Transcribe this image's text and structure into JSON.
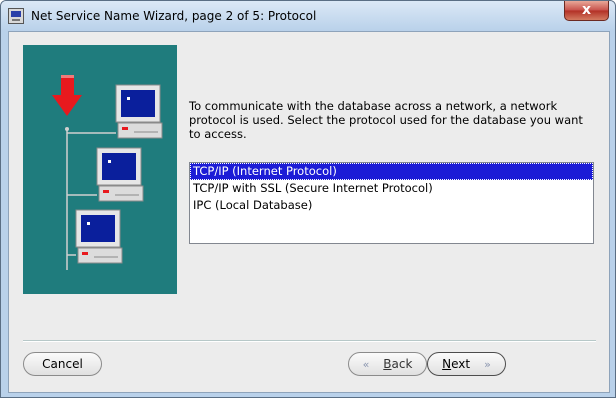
{
  "window": {
    "title": "Net Service Name Wizard, page 2 of 5: Protocol",
    "close_label": "x"
  },
  "main": {
    "description": "To communicate with the database across a network, a network protocol is used.  Select the protocol used for the database you want to access.",
    "protocols": [
      {
        "label": "TCP/IP (Internet Protocol)",
        "selected": true
      },
      {
        "label": "TCP/IP with SSL (Secure Internet Protocol)",
        "selected": false
      },
      {
        "label": "IPC (Local Database)",
        "selected": false
      }
    ]
  },
  "buttons": {
    "cancel": "Cancel",
    "back_key": "B",
    "back_rest": "ack",
    "next_key": "N",
    "next_rest": "ext",
    "back_icon": "«",
    "next_icon": "»"
  },
  "colors": {
    "illustration_bg": "#1f7c7d",
    "selection": "#1c1cd6",
    "arrow": "#e8191e",
    "monitor_screen": "#0a1f9c"
  }
}
